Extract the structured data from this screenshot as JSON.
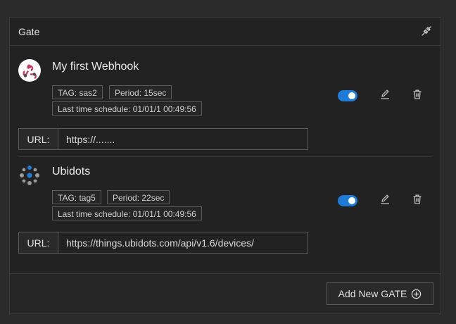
{
  "panel": {
    "title": "Gate"
  },
  "gates": [
    {
      "name": "My first Webhook",
      "logo": "webhook-logo",
      "tag": "TAG: sas2",
      "period": "Period: 15sec",
      "last_schedule": "Last time schedule: 01/01/1 00:49:56",
      "enabled": true,
      "url_label": "URL:",
      "url_value": "https://......."
    },
    {
      "name": "Ubidots",
      "logo": "ubidots-logo",
      "tag": "TAG: tag5",
      "period": "Period: 22sec",
      "last_schedule": "Last time schedule: 01/01/1 00:49:56",
      "enabled": true,
      "url_label": "URL:",
      "url_value": "https://things.ubidots.com/api/v1.6/devices/"
    }
  ],
  "footer": {
    "add_label": "Add New GATE"
  },
  "colors": {
    "accent": "#1e7bd8",
    "background": "#222222"
  }
}
